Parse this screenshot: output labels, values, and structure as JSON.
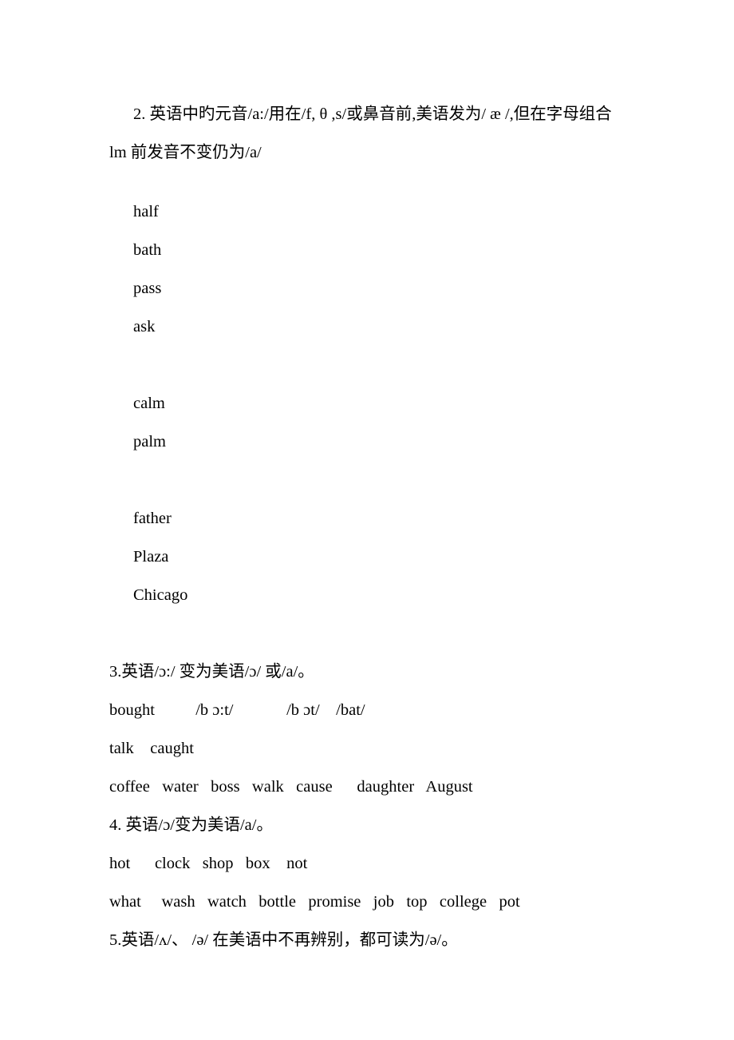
{
  "document": {
    "type": "study-notes",
    "language": "zh-CN",
    "topic": "British English to American English vowel changes",
    "text_color": "#000000",
    "background_color": "#ffffff"
  },
  "sections": [
    {
      "id": "item-2",
      "number": "2.",
      "heading": "2. 英语中旳元音/a:/用在/f, θ ,s/或鼻音前,美语发为/ æ /,但在字母组合 lm 前发音不变仍为/a/",
      "word_groups": [
        {
          "id": "group-a",
          "words": [
            "half",
            "bath",
            "pass",
            "ask"
          ]
        },
        {
          "id": "group-b",
          "words": [
            "calm",
            "palm"
          ]
        },
        {
          "id": "group-c",
          "words": [
            "father",
            "Plaza",
            "Chicago"
          ]
        }
      ]
    },
    {
      "id": "item-3",
      "heading": "3.英语/ɔ:/ 变为美语/ɔ/ 或/a/。",
      "example": {
        "word": "bought",
        "british": "/b ɔ:t/",
        "american_1": "/b ɔt/",
        "american_2": "/bat/"
      },
      "word_lines": [
        "talk    caught",
        "coffee   water   boss   walk   cause      daughter   August"
      ]
    },
    {
      "id": "item-4",
      "heading": "4. 英语/ɔ/变为美语/a/。",
      "word_lines": [
        "hot      clock   shop   box    not",
        "what     wash   watch   bottle   promise   job   top   college   pot"
      ]
    },
    {
      "id": "item-5",
      "heading": "5.英语/ʌ/、 /ə/ 在美语中不再辨别，都可读为/ə/。"
    }
  ]
}
